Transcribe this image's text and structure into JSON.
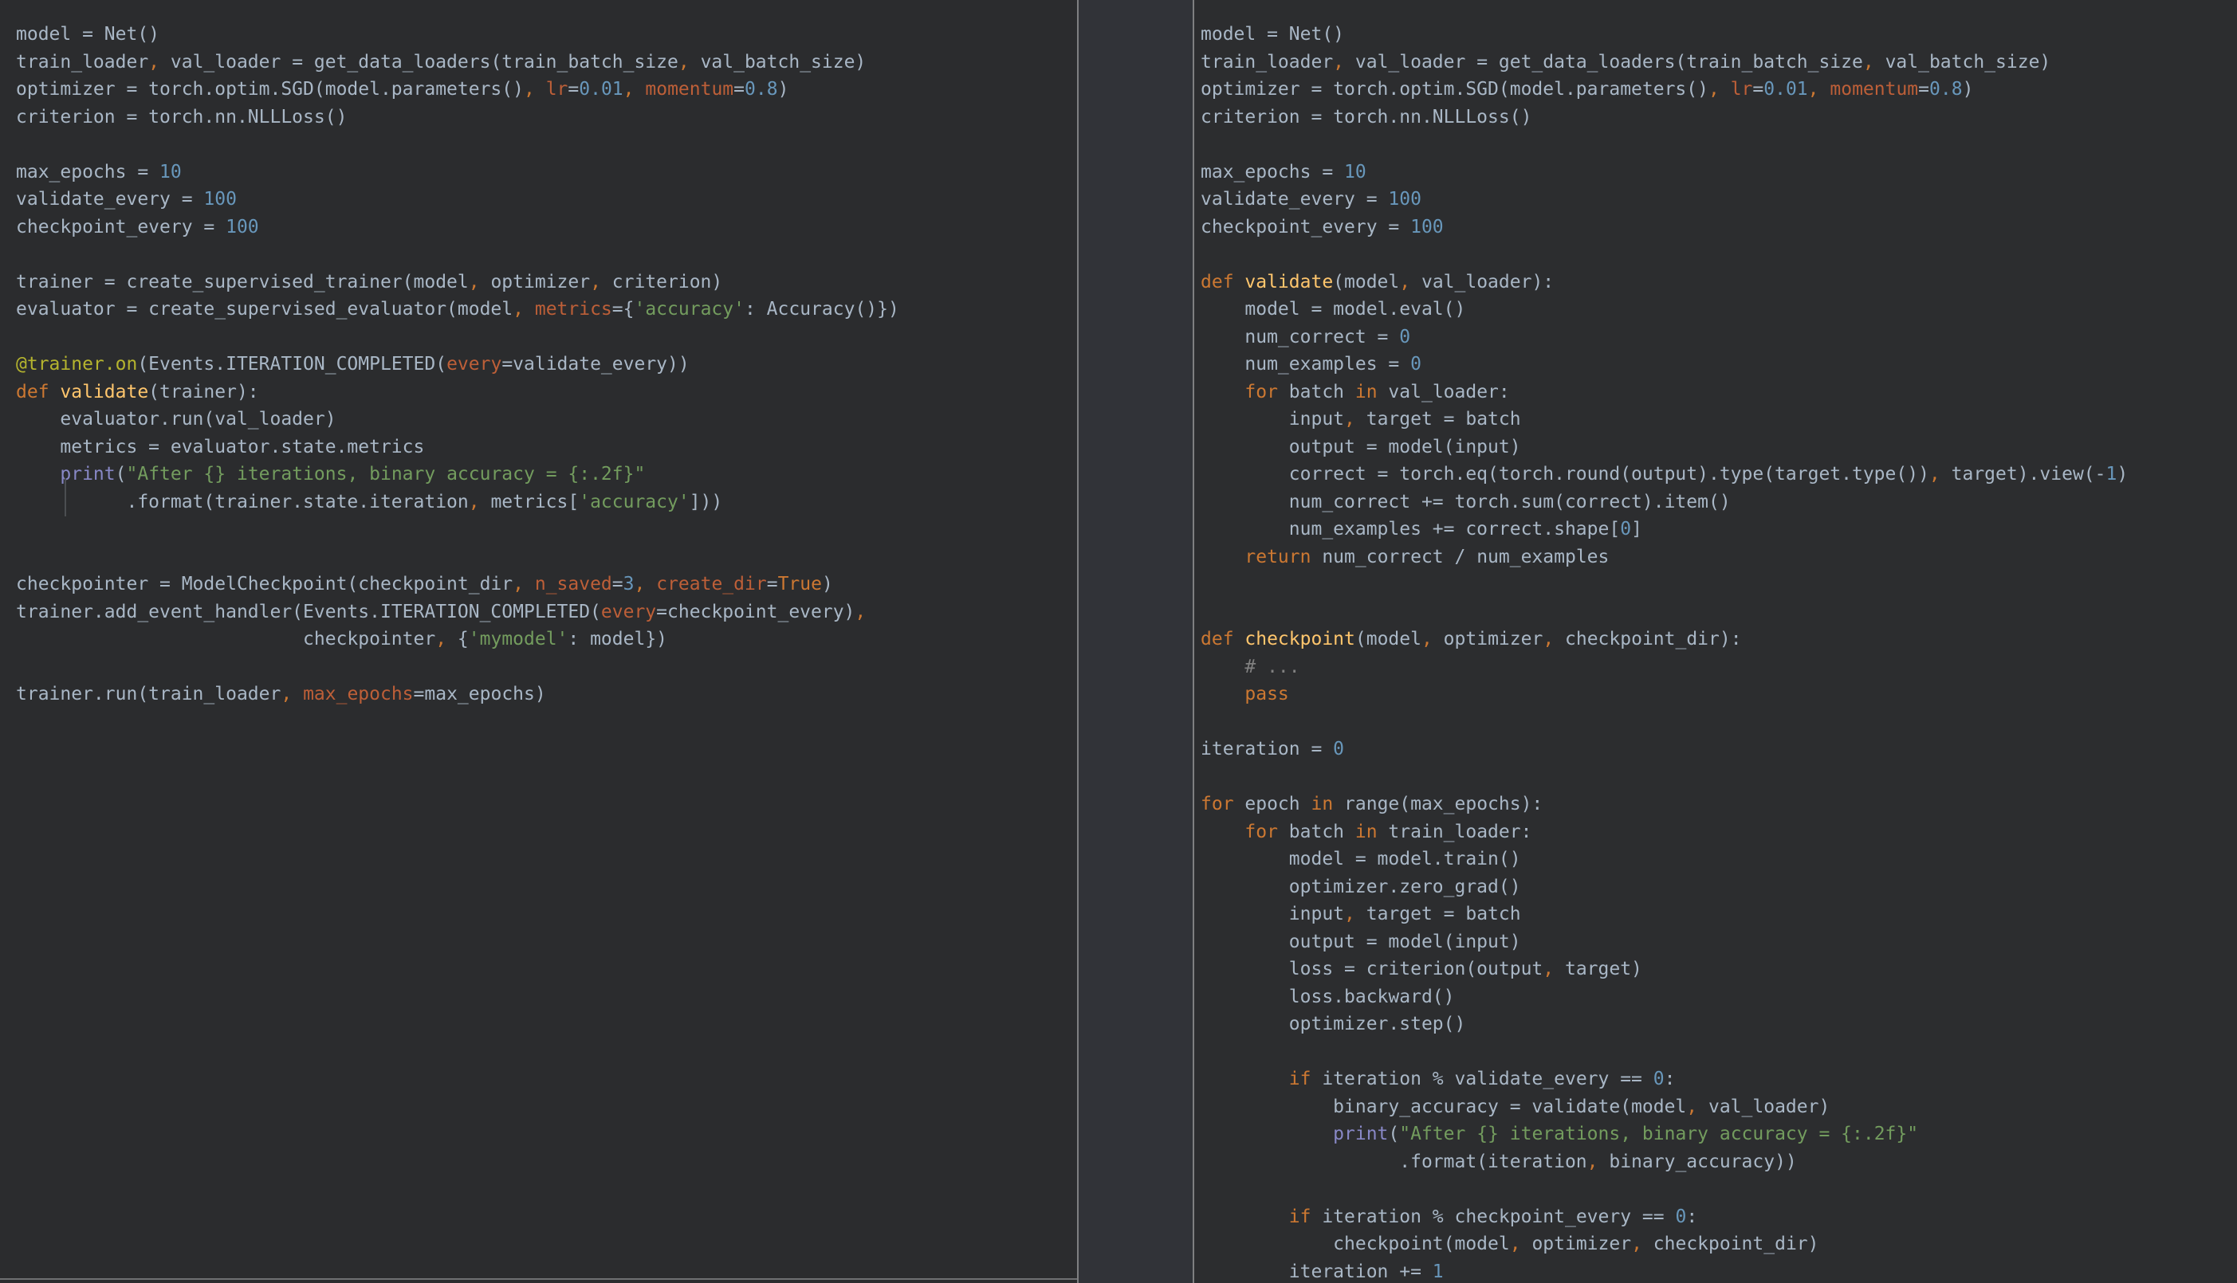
{
  "palette": {
    "editor_bg_left": "#2b2c2e",
    "editor_bg_right": "#2c2d2f",
    "gutter_bg": "#313338",
    "divider": "#7e7f81",
    "default": "#a9b7c6",
    "keyword": "#cc7832",
    "kwarg": "#bd5f38",
    "number": "#6897bb",
    "function_name": "#ffc66d",
    "decorator": "#b5b42e",
    "string": "#739c5e",
    "builtin_print": "#8888c6",
    "comment": "#808080",
    "indent_guide": "#4b4e51",
    "left_pane_bottom_border": "#6f7072"
  },
  "left_pane": {
    "language": "python",
    "lines": [
      [
        [
          "d",
          "model = Net()"
        ]
      ],
      [
        [
          "d",
          "train_loader"
        ],
        [
          "k",
          ","
        ],
        [
          "d",
          " val_loader = get_data_loaders(train_batch_size"
        ],
        [
          "k",
          ","
        ],
        [
          "d",
          " val_batch_size)"
        ]
      ],
      [
        [
          "d",
          "optimizer = torch.optim.SGD(model.parameters()"
        ],
        [
          "k",
          ","
        ],
        [
          "d",
          " "
        ],
        [
          "a",
          "lr"
        ],
        [
          "d",
          "="
        ],
        [
          "n",
          "0.01"
        ],
        [
          "k",
          ","
        ],
        [
          "d",
          " "
        ],
        [
          "a",
          "momentum"
        ],
        [
          "d",
          "="
        ],
        [
          "n",
          "0.8"
        ],
        [
          "d",
          ")"
        ]
      ],
      [
        [
          "d",
          "criterion = torch.nn.NLLLoss()"
        ]
      ],
      [],
      [
        [
          "d",
          "max_epochs = "
        ],
        [
          "n",
          "10"
        ]
      ],
      [
        [
          "d",
          "validate_every = "
        ],
        [
          "n",
          "100"
        ]
      ],
      [
        [
          "d",
          "checkpoint_every = "
        ],
        [
          "n",
          "100"
        ]
      ],
      [],
      [
        [
          "d",
          "trainer = create_supervised_trainer(model"
        ],
        [
          "k",
          ","
        ],
        [
          "d",
          " optimizer"
        ],
        [
          "k",
          ","
        ],
        [
          "d",
          " criterion)"
        ]
      ],
      [
        [
          "d",
          "evaluator = create_supervised_evaluator(model"
        ],
        [
          "k",
          ","
        ],
        [
          "d",
          " "
        ],
        [
          "a",
          "metrics"
        ],
        [
          "d",
          "={"
        ],
        [
          "s",
          "'accuracy'"
        ],
        [
          "d",
          ": Accuracy()})"
        ]
      ],
      [],
      [
        [
          "dec",
          "@trainer.on"
        ],
        [
          "d",
          "(Events.ITERATION_COMPLETED("
        ],
        [
          "a",
          "every"
        ],
        [
          "d",
          "=validate_every))"
        ]
      ],
      [
        [
          "k",
          "def "
        ],
        [
          "f",
          "validate"
        ],
        [
          "d",
          "(trainer):"
        ]
      ],
      [
        [
          "d",
          "    evaluator.run(val_loader)"
        ]
      ],
      [
        [
          "d",
          "    metrics = evaluator.state.metrics"
        ]
      ],
      [
        [
          "d",
          "    "
        ],
        [
          "b",
          "print"
        ],
        [
          "d",
          "("
        ],
        [
          "s",
          "\"After {} iterations, binary accuracy = {:.2f}\""
        ]
      ],
      [
        [
          "d",
          "          .format(trainer.state.iteration"
        ],
        [
          "k",
          ","
        ],
        [
          "d",
          " metrics["
        ],
        [
          "s",
          "'accuracy'"
        ],
        [
          "d",
          "]))"
        ]
      ],
      [],
      [],
      [
        [
          "d",
          "checkpointer = ModelCheckpoint(checkpoint_dir"
        ],
        [
          "k",
          ","
        ],
        [
          "d",
          " "
        ],
        [
          "a",
          "n_saved"
        ],
        [
          "d",
          "="
        ],
        [
          "n",
          "3"
        ],
        [
          "k",
          ","
        ],
        [
          "d",
          " "
        ],
        [
          "a",
          "create_dir"
        ],
        [
          "d",
          "="
        ],
        [
          "k",
          "True"
        ],
        [
          "d",
          ")"
        ]
      ],
      [
        [
          "d",
          "trainer.add_event_handler(Events.ITERATION_COMPLETED("
        ],
        [
          "a",
          "every"
        ],
        [
          "d",
          "=checkpoint_every)"
        ],
        [
          "k",
          ","
        ]
      ],
      [
        [
          "d",
          "                          checkpointer"
        ],
        [
          "k",
          ","
        ],
        [
          "d",
          " {"
        ],
        [
          "s",
          "'mymodel'"
        ],
        [
          "d",
          ": model})"
        ]
      ],
      [],
      [
        [
          "d",
          "trainer.run(train_loader"
        ],
        [
          "k",
          ","
        ],
        [
          "d",
          " "
        ],
        [
          "a",
          "max_epochs"
        ],
        [
          "d",
          "=max_epochs)"
        ]
      ]
    ]
  },
  "right_pane": {
    "language": "python",
    "lines": [
      [
        [
          "d",
          "model = Net()"
        ]
      ],
      [
        [
          "d",
          "train_loader"
        ],
        [
          "k",
          ","
        ],
        [
          "d",
          " val_loader = get_data_loaders(train_batch_size"
        ],
        [
          "k",
          ","
        ],
        [
          "d",
          " val_batch_size)"
        ]
      ],
      [
        [
          "d",
          "optimizer = torch.optim.SGD(model.parameters()"
        ],
        [
          "k",
          ","
        ],
        [
          "d",
          " "
        ],
        [
          "a",
          "lr"
        ],
        [
          "d",
          "="
        ],
        [
          "n",
          "0.01"
        ],
        [
          "k",
          ","
        ],
        [
          "d",
          " "
        ],
        [
          "a",
          "momentum"
        ],
        [
          "d",
          "="
        ],
        [
          "n",
          "0.8"
        ],
        [
          "d",
          ")"
        ]
      ],
      [
        [
          "d",
          "criterion = torch.nn.NLLLoss()"
        ]
      ],
      [],
      [
        [
          "d",
          "max_epochs = "
        ],
        [
          "n",
          "10"
        ]
      ],
      [
        [
          "d",
          "validate_every = "
        ],
        [
          "n",
          "100"
        ]
      ],
      [
        [
          "d",
          "checkpoint_every = "
        ],
        [
          "n",
          "100"
        ]
      ],
      [],
      [
        [
          "k",
          "def "
        ],
        [
          "f",
          "validate"
        ],
        [
          "d",
          "(model"
        ],
        [
          "k",
          ","
        ],
        [
          "d",
          " val_loader):"
        ]
      ],
      [
        [
          "d",
          "    model = model.eval()"
        ]
      ],
      [
        [
          "d",
          "    num_correct = "
        ],
        [
          "n",
          "0"
        ]
      ],
      [
        [
          "d",
          "    num_examples = "
        ],
        [
          "n",
          "0"
        ]
      ],
      [
        [
          "d",
          "    "
        ],
        [
          "k",
          "for"
        ],
        [
          "d",
          " batch "
        ],
        [
          "k",
          "in"
        ],
        [
          "d",
          " val_loader:"
        ]
      ],
      [
        [
          "d",
          "        input"
        ],
        [
          "k",
          ","
        ],
        [
          "d",
          " target = batch"
        ]
      ],
      [
        [
          "d",
          "        output = model(input)"
        ]
      ],
      [
        [
          "d",
          "        correct = torch.eq(torch.round(output).type(target.type())"
        ],
        [
          "k",
          ","
        ],
        [
          "d",
          " target).view(-"
        ],
        [
          "n",
          "1"
        ],
        [
          "d",
          ")"
        ]
      ],
      [
        [
          "d",
          "        num_correct += torch.sum(correct).item()"
        ]
      ],
      [
        [
          "d",
          "        num_examples += correct.shape["
        ],
        [
          "n",
          "0"
        ],
        [
          "d",
          "]"
        ]
      ],
      [
        [
          "d",
          "    "
        ],
        [
          "k",
          "return"
        ],
        [
          "d",
          " num_correct / num_examples"
        ]
      ],
      [],
      [],
      [
        [
          "k",
          "def "
        ],
        [
          "f",
          "checkpoint"
        ],
        [
          "d",
          "(model"
        ],
        [
          "k",
          ","
        ],
        [
          "d",
          " optimizer"
        ],
        [
          "k",
          ","
        ],
        [
          "d",
          " checkpoint_dir):"
        ]
      ],
      [
        [
          "d",
          "    "
        ],
        [
          "c",
          "# ..."
        ]
      ],
      [
        [
          "d",
          "    "
        ],
        [
          "k",
          "pass"
        ]
      ],
      [],
      [
        [
          "d",
          "iteration = "
        ],
        [
          "n",
          "0"
        ]
      ],
      [],
      [
        [
          "k",
          "for"
        ],
        [
          "d",
          " epoch "
        ],
        [
          "k",
          "in"
        ],
        [
          "d",
          " range(max_epochs):"
        ]
      ],
      [
        [
          "d",
          "    "
        ],
        [
          "k",
          "for"
        ],
        [
          "d",
          " batch "
        ],
        [
          "k",
          "in"
        ],
        [
          "d",
          " train_loader:"
        ]
      ],
      [
        [
          "d",
          "        model = model.train()"
        ]
      ],
      [
        [
          "d",
          "        optimizer.zero_grad()"
        ]
      ],
      [
        [
          "d",
          "        input"
        ],
        [
          "k",
          ","
        ],
        [
          "d",
          " target = batch"
        ]
      ],
      [
        [
          "d",
          "        output = model(input)"
        ]
      ],
      [
        [
          "d",
          "        loss = criterion(output"
        ],
        [
          "k",
          ","
        ],
        [
          "d",
          " target)"
        ]
      ],
      [
        [
          "d",
          "        loss.backward()"
        ]
      ],
      [
        [
          "d",
          "        optimizer.step()"
        ]
      ],
      [],
      [
        [
          "d",
          "        "
        ],
        [
          "k",
          "if"
        ],
        [
          "d",
          " iteration % validate_every == "
        ],
        [
          "n",
          "0"
        ],
        [
          "d",
          ":"
        ]
      ],
      [
        [
          "d",
          "            binary_accuracy = validate(model"
        ],
        [
          "k",
          ","
        ],
        [
          "d",
          " val_loader)"
        ]
      ],
      [
        [
          "d",
          "            "
        ],
        [
          "b",
          "print"
        ],
        [
          "d",
          "("
        ],
        [
          "s",
          "\"After {} iterations, binary accuracy = {:.2f}\""
        ]
      ],
      [
        [
          "d",
          "                  .format(iteration"
        ],
        [
          "k",
          ","
        ],
        [
          "d",
          " binary_accuracy))"
        ]
      ],
      [],
      [
        [
          "d",
          "        "
        ],
        [
          "k",
          "if"
        ],
        [
          "d",
          " iteration % checkpoint_every == "
        ],
        [
          "n",
          "0"
        ],
        [
          "d",
          ":"
        ]
      ],
      [
        [
          "d",
          "            checkpoint(model"
        ],
        [
          "k",
          ","
        ],
        [
          "d",
          " optimizer"
        ],
        [
          "k",
          ","
        ],
        [
          "d",
          " checkpoint_dir)"
        ]
      ],
      [
        [
          "d",
          "        iteration += "
        ],
        [
          "n",
          "1"
        ]
      ]
    ]
  }
}
